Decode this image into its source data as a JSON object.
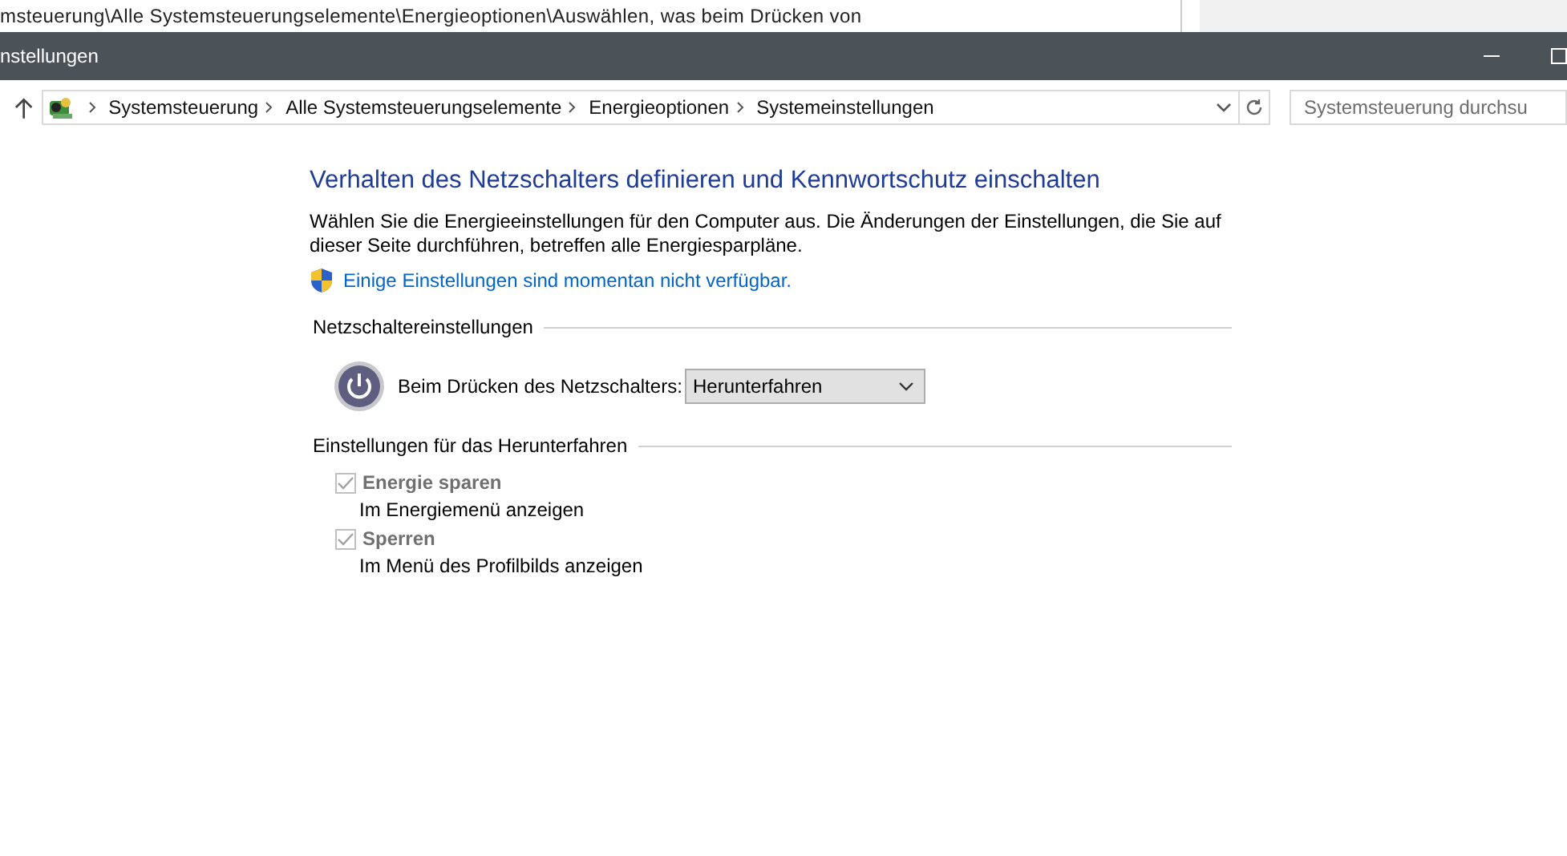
{
  "background_window": {
    "path_text": "msteuerung\\Alle Systemsteuerungselemente\\Energieoptionen\\Auswählen, was beim Drücken von"
  },
  "window": {
    "title": "nstellungen"
  },
  "address_bar": {
    "breadcrumbs": [
      "Systemsteuerung",
      "Alle Systemsteuerungselemente",
      "Energieoptionen",
      "Systemeinstellungen"
    ],
    "search_placeholder": "Systemsteuerung durchsu"
  },
  "content": {
    "heading": "Verhalten des Netzschalters definieren und Kennwortschutz einschalten",
    "description": "Wählen Sie die Energieeinstellungen für den Computer aus. Die Änderungen der Einstellungen, die Sie auf dieser Seite durchführen, betreffen alle Energiesparpläne.",
    "admin_link": "Einige Einstellungen sind momentan nicht verfügbar.",
    "power_button_section": {
      "title": "Netzschaltereinstellungen",
      "label": "Beim Drücken des Netzschalters:",
      "value": "Herunterfahren"
    },
    "shutdown_section": {
      "title": "Einstellungen für das Herunterfahren",
      "options": [
        {
          "label": "Energie sparen",
          "description": "Im Energiemenü anzeigen",
          "checked": true,
          "disabled": true
        },
        {
          "label": "Sperren",
          "description": "Im Menü des Profilbilds anzeigen",
          "checked": true,
          "disabled": true
        }
      ]
    }
  }
}
